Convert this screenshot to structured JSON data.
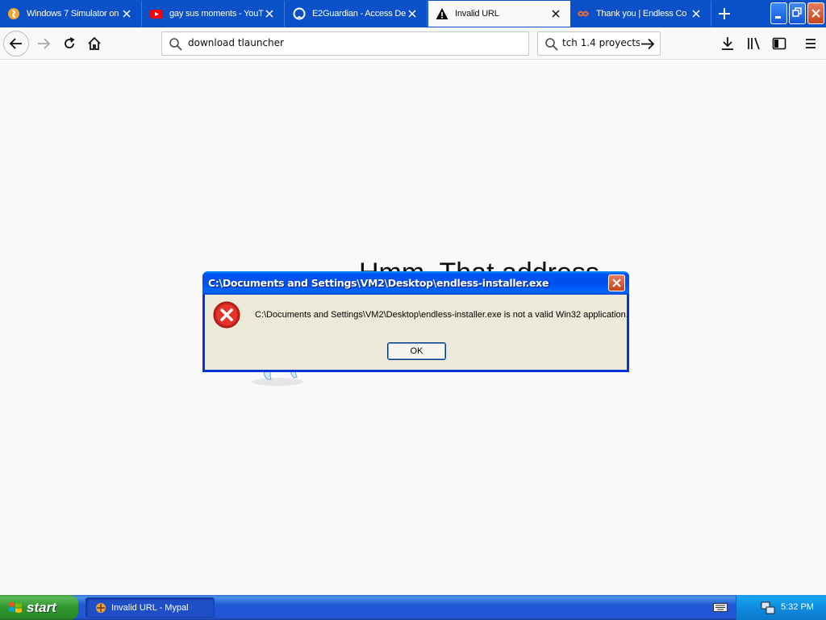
{
  "browser": {
    "tabs": [
      {
        "title": "Windows 7 Simulator on",
        "icon": "scratch-icon",
        "active": false
      },
      {
        "title": "gay sus moments - YouT",
        "icon": "youtube-icon",
        "active": false
      },
      {
        "title": "E2Guardian - Access De",
        "icon": "github-icon",
        "active": false
      },
      {
        "title": "Invalid URL",
        "icon": "warning-icon",
        "active": true
      },
      {
        "title": "Thank you | Endless Co",
        "icon": "endless-icon",
        "active": false
      }
    ],
    "address_bar": {
      "value": "download tlauncher"
    },
    "search_bar": {
      "value": "tch 1.4 proyects"
    }
  },
  "page": {
    "heading": "Hmm. That address"
  },
  "dialog": {
    "title": "C:\\Documents and Settings\\VM2\\Desktop\\endless-installer.exe",
    "message": "C:\\Documents and Settings\\VM2\\Desktop\\endless-installer.exe is not a valid Win32 application.",
    "ok_label": "OK"
  },
  "taskbar": {
    "start_label": "start",
    "task_label": "Invalid URL - Mypal",
    "clock": "5:32 PM"
  },
  "colors": {
    "tabstrip": "#0a50c9",
    "dialog_title": "#0054e3",
    "dialog_body": "#ece9d8",
    "taskbar": "#245edb",
    "start": "#3c9b3c"
  }
}
